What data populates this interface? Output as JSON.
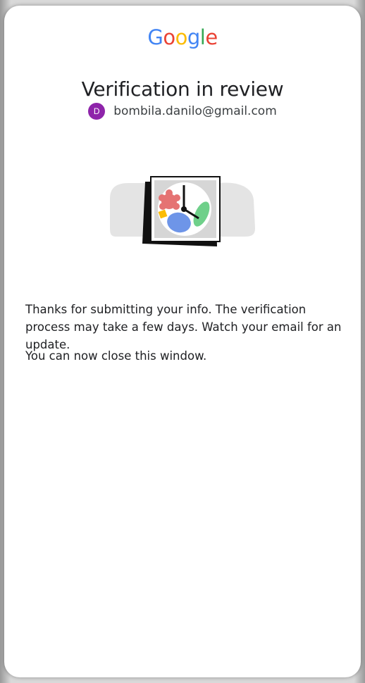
{
  "logo": {
    "text": "Google",
    "letters": [
      {
        "char": "G",
        "color": "#4285F4"
      },
      {
        "char": "o",
        "color": "#EA4335"
      },
      {
        "char": "o",
        "color": "#FBBC05"
      },
      {
        "char": "g",
        "color": "#4285F4"
      },
      {
        "char": "l",
        "color": "#34A853"
      },
      {
        "char": "e",
        "color": "#EA4335"
      }
    ]
  },
  "page": {
    "title": "Verification in review"
  },
  "account": {
    "avatar_initial": "D",
    "avatar_color": "#8e24aa",
    "email": "bombila.danilo@gmail.com"
  },
  "illustration": {
    "icon": "clock-review-illustration"
  },
  "content": {
    "paragraph1": "Thanks for submitting your info. The verification process may take a few days. Watch your email for an update.",
    "paragraph2": "You can now close this window."
  }
}
